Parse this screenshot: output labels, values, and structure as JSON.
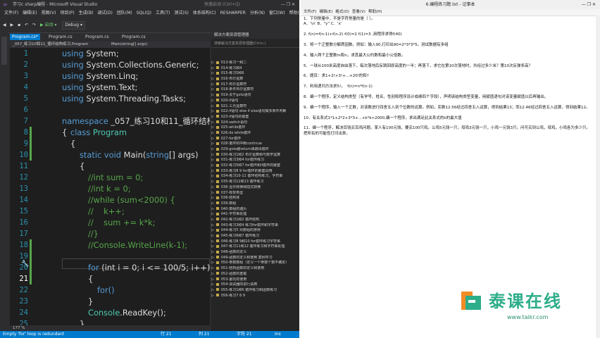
{
  "vs": {
    "title": "学习c sharp编程 - Microsoft Visual Studio",
    "quick_launch": "快速启动 (Ctrl+Q)",
    "menu": [
      "文件(F)",
      "编辑(E)",
      "视图(V)",
      "项目(P)",
      "生成(B)",
      "调试(D)",
      "团队(M)",
      "SQL(Q)",
      "工具(T)",
      "测试(S)",
      "体系结构(C)",
      "RESHARPER",
      "分析(N)",
      "窗口(W)",
      "帮助(H)"
    ],
    "toolbar": {
      "start": "▶ 启动 ▾",
      "config": "Debug ▾"
    },
    "tabs": [
      "Program.cs*",
      "Program.cs",
      "Program.cs",
      "Program.cs"
    ],
    "navbar": {
      "left": "_057_练习10和11_循环结构练习.Program",
      "right": "Main(string[] args)"
    },
    "line_numbers": [
      "1",
      "2",
      "3",
      "4",
      "5",
      "6",
      "7",
      "8",
      "9",
      "10",
      "11",
      "12",
      "13",
      "14",
      "15",
      "16",
      "17",
      "18",
      "19",
      "20",
      "21",
      "22",
      "23",
      "24",
      "25"
    ],
    "zoom": "177 %",
    "status": {
      "message": "Empty 'for' loop is redundant",
      "line": "行 21",
      "col": "列 21",
      "char": "字符 21",
      "mode": "Ins"
    }
  },
  "code": {
    "l1": "System;",
    "l2": "System.Collections.Generic;",
    "l3": "System.Linq;",
    "l4": "System.Text;",
    "l5": "System.Threading.Tasks;",
    "kw_using": "using",
    "kw_namespace": "namespace",
    "ns_name": " _057_练习10和11_循环结构练",
    "kw_class": "class",
    "cls_program": "Program",
    "brace_open": "{",
    "brace_close": "}",
    "kw_static": "static void",
    "main_sig": "Main(",
    "main_type": "string",
    "main_rest": "[] args)",
    "c_int_sum": "//int sum = 0;",
    "c_int_k": "//int k = 0;",
    "c_while": "//while (sum<2000) {",
    "c_kpp": "//    k++;",
    "c_sum": "//    sum += k*k;",
    "c_close": "//}",
    "c_console": "//Console.WriteLine(k-1);",
    "kw_for": "for",
    "for_rest": " (int i = 0; i <= 100/5; i++)",
    "for_partial": "for()",
    "console_class": "Console",
    "console_rest": ".ReadKey();"
  },
  "solution": {
    "header": "解决方案资源管理器",
    "search_placeholder": "搜索解决方案资源管理器(Ctrl+;)",
    "items": [
      "013-练习一和二",
      "014-练习和4",
      "015-练习5和6",
      "016-布尔运算",
      "017-布尔运算符",
      "018-条件布尔运算符",
      "019-关于goto语句",
      "020-if语句",
      "021-三元运算符",
      "022-if语句 else if else语句做多条件判断",
      "023-if语句的嵌套",
      "024-switch语句",
      "025-while循环",
      "026-do while循环",
      "027-for循环",
      "028-循环的中断continue",
      "029-goto跟return来跳出循环",
      "030-练习1和2 布尔运算和与数学运算",
      "031-练习3和4 for循环练习",
      "032-练习5和7 for循环和if循环的嵌套",
      "033-练习8 9 for循环的嵌套调用",
      "034-练习10-11 循环结构练习，字符串",
      "035-练习12和13 循环练习",
      "036-显示转换和隐式转换",
      "037-枚举类型",
      "038-结构体",
      "039-数组",
      "040-数组的遍历",
      "041-字符串处理",
      "042-练习1和2 循环结构",
      "043-练习3和4 练习for循环和字符串",
      "044-练习5 对数组的排序",
      "045-练习6和7 循环练习",
      "046-练习8 9和10 for循环练习字符串",
      "047-练习11和12 循环练习和字符串处理",
      "048-函数的定义",
      "049-函数的定义和使用 案例学习",
      "050-参数数组（定义一个参数个数不确定）",
      "051-结构函数的定义和使用",
      "052-函数的重载",
      "053-委托的使用",
      "054-调试器的进行调用",
      "055-练习1和6 循环练习和函数练习",
      "056-练习7 8 9"
    ]
  },
  "notepad": {
    "title": "6.编程练习题.txt - 记事本",
    "menu": [
      "文件(F)",
      "编辑(E)",
      "格式(O)",
      "查看(V)",
      "帮助(H)"
    ],
    "lines": [
      "1．下列常量中，不是字符常量的是（ ）。",
      "A．'\\n' B．\"y\" C．'x'",
      "",
      "2. f(n)=f(n-1)+f(n-2) f(0)=2 f(1)=3 ,用程序求得f(40)",
      "",
      "3．将一个正整数分解质因数。例如：输入90,打印出90=2*3*3*5。测试数据有多组",
      "",
      "4．输入两个正整数m和n，求其最大公约数和最小公倍数。",
      "",
      "5．一球从100米高度自由落下，每次落地后反跳回原高度的一半；再落下，求它在第10次落地时，共经过多少米？第10次反弹多高？",
      "",
      "6．题目：求1+2!+3!+...+20!的和?",
      "",
      "7．利用递归方法求5!。  f(n)=n*f(n-1)",
      "",
      "8．编一个程序，定义结构类型（有学号、姓名、性别和程序设计成绩四个字段），声明该结构类型变量，用赋值语句对该变量赋值以后再输出。",
      "",
      "9．编一个程序，输入一个正数，对该数进行四舍五入到个位数的运算。例如，实数12.56经过四舍五入运算，得到结果13；而12.46经过四舍五入运算，得到结果12。",
      "",
      "10．有关系式1*1+2*2+3*3+...+k*k<2000,编一个程序，求出满足此关系式的k的最大值",
      "",
      "11．编一个程序，解决百钱买百鸡问题。某人有100元钱，要买100只鸡。公鸡5元钱一只，母鸡3元钱一只，小鸡一元钱3只。问可买到公鸡，母鸡，小鸡各为多少只。把所有的可能性打印出来。"
    ]
  },
  "brand": {
    "name": "泰课在线",
    "url": "www.taikr.com"
  },
  "colors": {
    "vs_bg": "#2d2d30",
    "editor_bg": "#1e1e1e",
    "keyword": "#569cd6",
    "type": "#4ec9b0",
    "comment": "#57a64a",
    "accent": "#007acc",
    "brand": "#2dad8a"
  }
}
